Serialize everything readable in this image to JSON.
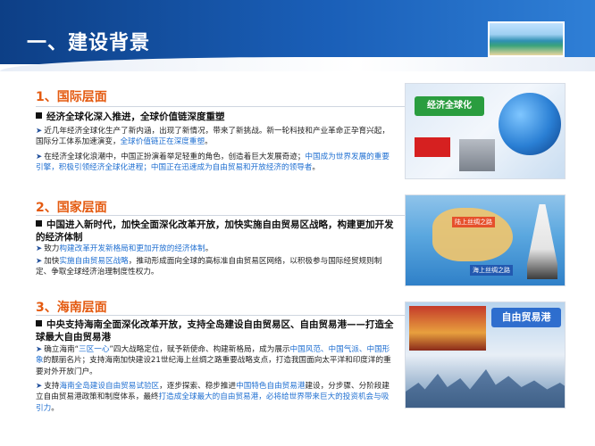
{
  "page": {
    "title": "一、建设背景"
  },
  "sections": [
    {
      "title": "1、国际层面",
      "headline": "经济全球化深入推进，全球价值链深度重塑",
      "bullets": [
        {
          "runs": [
            {
              "text": "近几年经济全球化生产了新内涵，出现了新情况，带来了新挑战。新一轮科技和产业革命正孕育兴起，国际分工体系加速演变，",
              "hl": false
            },
            {
              "text": "全球价值链正在深度重塑",
              "hl": true
            },
            {
              "text": "。",
              "hl": false
            }
          ]
        },
        {
          "runs": [
            {
              "text": "在经济全球化浪潮中，中国正扮演着举足轻重的角色，创造着巨大发展奇迹；",
              "hl": false
            },
            {
              "text": "中国成为世界发展的重要引擎，积极引领经济全球化进程；中国正在迅速成为自由贸易和开放经济的领导者",
              "hl": true
            },
            {
              "text": "。",
              "hl": false
            }
          ]
        }
      ],
      "image": {
        "badge": "经济全球化"
      }
    },
    {
      "title": "2、国家层面",
      "headline": "中国进入新时代，加快全面深化改革开放，加快实施自由贸易区战略，构建更加开发的经济体制",
      "bullets": [
        {
          "runs": [
            {
              "text": "致力",
              "hl": false
            },
            {
              "text": "构建改革开发新格局和更加开放的经济体制",
              "hl": true
            },
            {
              "text": "。",
              "hl": false
            }
          ]
        },
        {
          "runs": [
            {
              "text": "加快",
              "hl": false
            },
            {
              "text": "实施自由贸易区战略",
              "hl": true
            },
            {
              "text": "，推动形成面向全球的高标准自由贸易区网络，以积极参与国际经贸规则制定、争取全球经济治理制度性权力。",
              "hl": false
            }
          ]
        }
      ],
      "image": {
        "label1": "陆上丝绸之路",
        "label2": "海上丝绸之路"
      }
    },
    {
      "title": "3、海南层面",
      "headline": "中央支持海南全面深化改革开放，支持全岛建设自由贸易区、自由贸易港——打造全球最大自由贸易港",
      "bullets": [
        {
          "runs": [
            {
              "text": "确立海南“",
              "hl": false
            },
            {
              "text": "三区一心",
              "hl": true
            },
            {
              "text": "”四大战略定位，赋予新使命、构建新格局，成为展示",
              "hl": false
            },
            {
              "text": "中国风范、中国气派、中国形象",
              "hl": true
            },
            {
              "text": "的靓丽名片；支持海南加快建设21世纪海上丝绸之路重要战略支点，打造我国面向太平洋和印度洋的重要对外开放门户。",
              "hl": false
            }
          ]
        },
        {
          "runs": [
            {
              "text": "支持",
              "hl": false
            },
            {
              "text": "海南全岛建设自由贸易试验区",
              "hl": true
            },
            {
              "text": "，逐步探索、稳步推进",
              "hl": false
            },
            {
              "text": "中国特色自由贸易港",
              "hl": true
            },
            {
              "text": "建设，分步骤、分阶段建立自由贸易港政策和制度体系，最终",
              "hl": false
            },
            {
              "text": "打造成全球最大的自由贸易港，必将给世界带来巨大的投资机会与吸引力",
              "hl": true
            },
            {
              "text": "。",
              "hl": false
            }
          ]
        }
      ],
      "image": {
        "label": "自由贸易港"
      }
    }
  ]
}
